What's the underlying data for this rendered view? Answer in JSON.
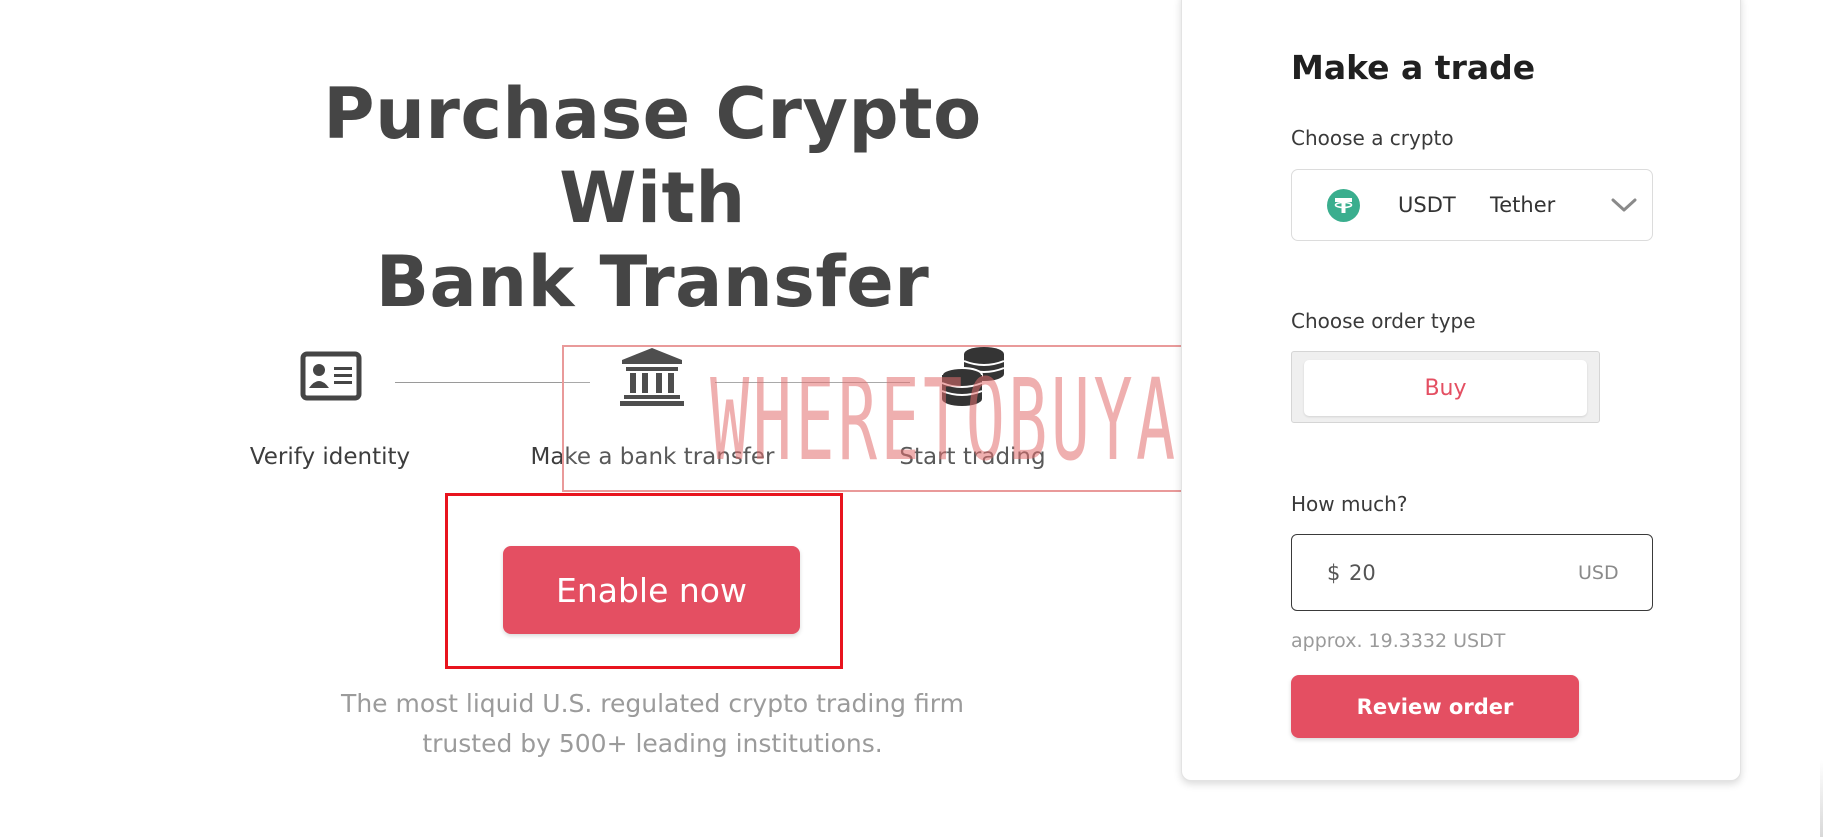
{
  "hero": {
    "title_line1": "Purchase Crypto With",
    "title_line2": "Bank Transfer",
    "tagline_line1": "The most liquid U.S. regulated crypto trading firm",
    "tagline_line2": "trusted by 500+ leading institutions.",
    "enable_label": "Enable now"
  },
  "steps": [
    {
      "label": "Verify identity",
      "icon": "id-card-icon"
    },
    {
      "label": "Make a bank transfer",
      "icon": "bank-icon"
    },
    {
      "label": "Start trading",
      "icon": "coins-icon"
    }
  ],
  "watermark": {
    "text": "WHERETOBUYALTS"
  },
  "trade": {
    "title": "Make a trade",
    "crypto_label": "Choose a crypto",
    "crypto_symbol": "USDT",
    "crypto_name": "Tether",
    "order_type_label": "Choose order type",
    "order_type_value": "Buy",
    "amount_label": "How much?",
    "currency_prefix": "$",
    "amount_value": "20",
    "currency_unit": "USD",
    "approx_text": "approx. 19.3332 USDT",
    "review_label": "Review order"
  },
  "colors": {
    "accent": "#e44f62",
    "tether_green": "#3aae8e",
    "highlight_red": "#e8141e",
    "watermark": "#e26e6e"
  }
}
